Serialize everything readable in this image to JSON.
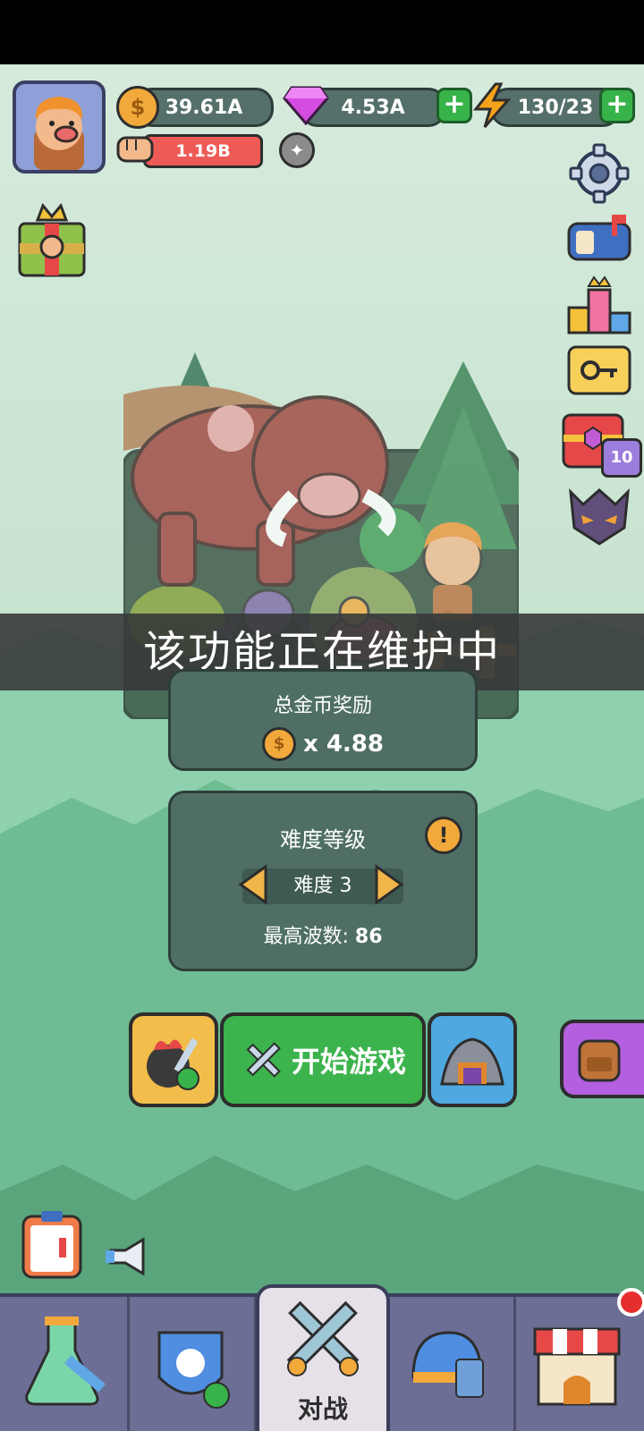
{
  "resources": {
    "gold": "39.61A",
    "gems": "4.53A",
    "energy": "130/23",
    "power": "1.19B"
  },
  "overlay": {
    "message": "该功能正在维护中"
  },
  "reward": {
    "title": "总金币奖励",
    "value": "x 4.88"
  },
  "difficulty": {
    "title": "难度等级",
    "current": "难度 3",
    "max_wave_label": "最高波数:",
    "max_wave_value": "86"
  },
  "actions": {
    "start": "开始游戏"
  },
  "side": {
    "chest_count": "10"
  },
  "bottom_nav": {
    "items": [
      {
        "name": "lab",
        "label": ""
      },
      {
        "name": "hero",
        "label": ""
      },
      {
        "name": "battle",
        "label": "对战"
      },
      {
        "name": "gear",
        "label": ""
      },
      {
        "name": "shop",
        "label": ""
      }
    ]
  },
  "colors": {
    "accent_green": "#37b34a",
    "panel": "#4f6f66",
    "nav": "#6c6e95"
  }
}
